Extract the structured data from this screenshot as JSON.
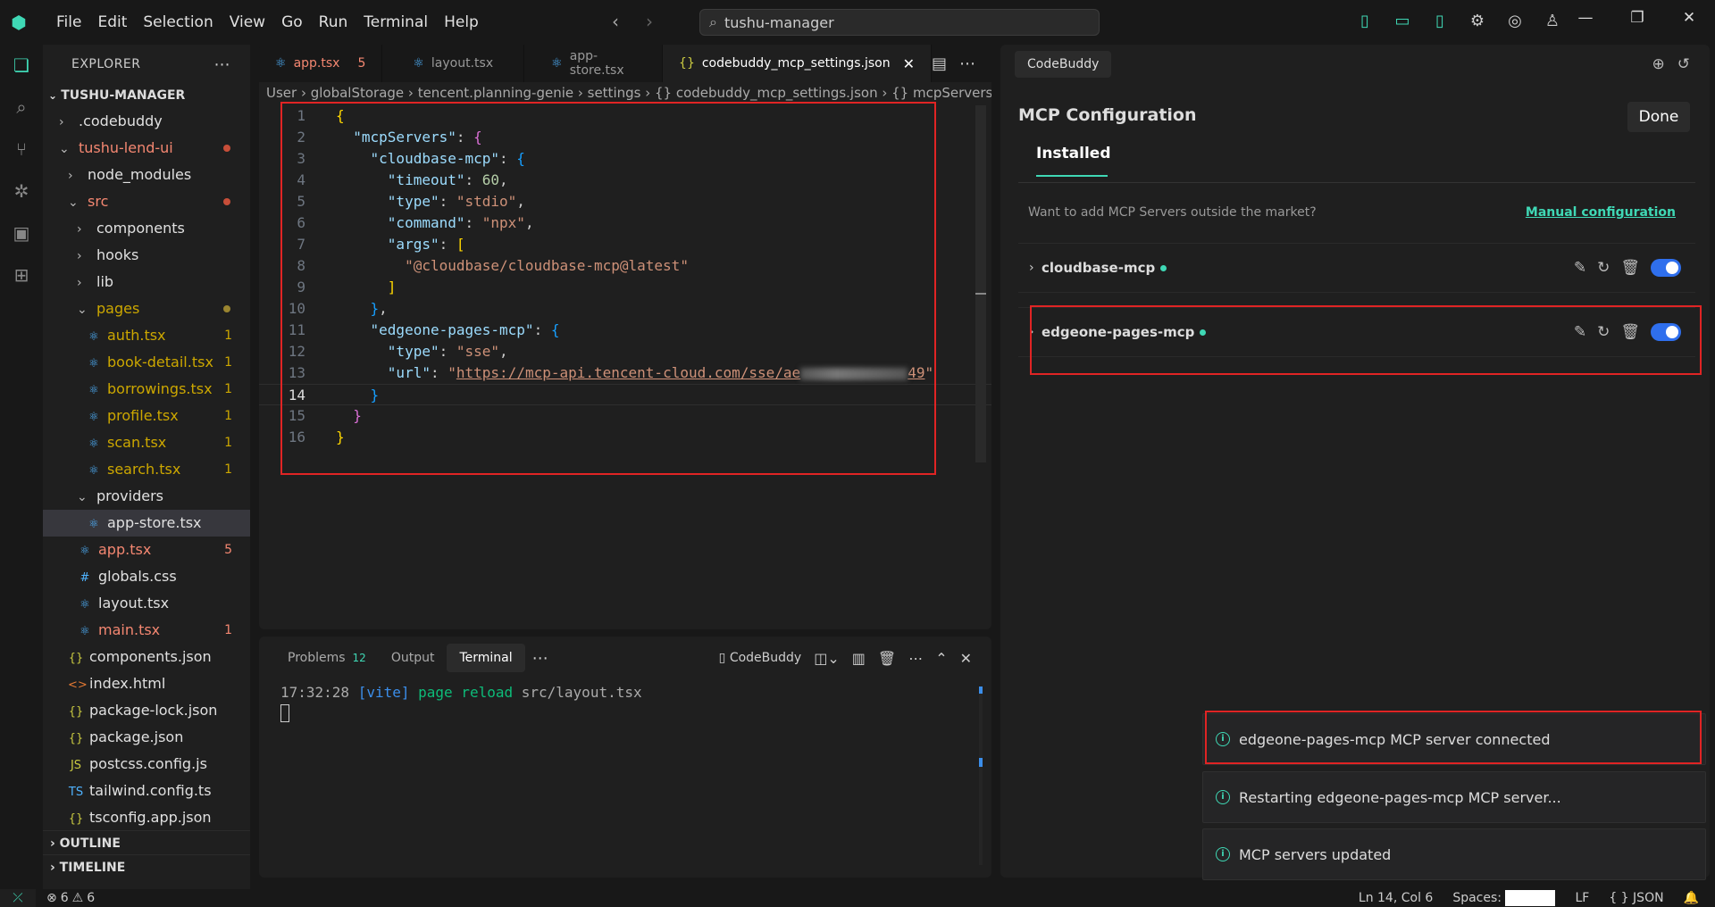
{
  "window": {
    "menu": [
      "File",
      "Edit",
      "Selection",
      "View",
      "Go",
      "Run",
      "Terminal",
      "Help"
    ],
    "search_text": "tushu-manager"
  },
  "explorer": {
    "header": "EXPLORER",
    "root": "TUSHU-MANAGER",
    "items": [
      {
        "label": ".codebuddy",
        "type": "folder",
        "open": false,
        "depth": 1
      },
      {
        "label": "tushu-lend-ui",
        "type": "folder",
        "open": true,
        "depth": 1,
        "status": "err-dot"
      },
      {
        "label": "node_modules",
        "type": "folder",
        "open": false,
        "depth": 2
      },
      {
        "label": "src",
        "type": "folder",
        "open": true,
        "depth": 2,
        "status": "err-dot"
      },
      {
        "label": "components",
        "type": "folder",
        "open": false,
        "depth": 3
      },
      {
        "label": "hooks",
        "type": "folder",
        "open": false,
        "depth": 3
      },
      {
        "label": "lib",
        "type": "folder",
        "open": false,
        "depth": 3
      },
      {
        "label": "pages",
        "type": "folder",
        "open": true,
        "depth": 3,
        "status": "warn-dot"
      },
      {
        "label": "auth.tsx",
        "type": "react",
        "depth": 4,
        "badge": "1",
        "color": "warn"
      },
      {
        "label": "book-detail.tsx",
        "type": "react",
        "depth": 4,
        "badge": "1",
        "color": "warn"
      },
      {
        "label": "borrowings.tsx",
        "type": "react",
        "depth": 4,
        "badge": "1",
        "color": "warn"
      },
      {
        "label": "profile.tsx",
        "type": "react",
        "depth": 4,
        "badge": "1",
        "color": "warn"
      },
      {
        "label": "scan.tsx",
        "type": "react",
        "depth": 4,
        "badge": "1",
        "color": "warn"
      },
      {
        "label": "search.tsx",
        "type": "react",
        "depth": 4,
        "badge": "1",
        "color": "warn"
      },
      {
        "label": "providers",
        "type": "folder",
        "open": true,
        "depth": 3
      },
      {
        "label": "app-store.tsx",
        "type": "react",
        "depth": 4,
        "selected": true
      },
      {
        "label": "app.tsx",
        "type": "react",
        "depth": 3,
        "badge": "5",
        "color": "err"
      },
      {
        "label": "globals.css",
        "type": "css",
        "depth": 3
      },
      {
        "label": "layout.tsx",
        "type": "react",
        "depth": 3
      },
      {
        "label": "main.tsx",
        "type": "react",
        "depth": 3,
        "badge": "1",
        "color": "err"
      },
      {
        "label": "components.json",
        "type": "json",
        "depth": 2
      },
      {
        "label": "index.html",
        "type": "html",
        "depth": 2
      },
      {
        "label": "package-lock.json",
        "type": "json",
        "depth": 2
      },
      {
        "label": "package.json",
        "type": "json",
        "depth": 2
      },
      {
        "label": "postcss.config.js",
        "type": "js",
        "depth": 2
      },
      {
        "label": "tailwind.config.ts",
        "type": "ts",
        "depth": 2
      },
      {
        "label": "tsconfig.app.json",
        "type": "json",
        "depth": 2
      }
    ],
    "outline": "OUTLINE",
    "timeline": "TIMELINE"
  },
  "editor": {
    "tabs": [
      {
        "label": "app.tsx",
        "badge": "5",
        "icon": "react-icon"
      },
      {
        "label": "layout.tsx",
        "icon": "react-icon"
      },
      {
        "label": "app-store.tsx",
        "icon": "react-icon"
      },
      {
        "label": "codebuddy_mcp_settings.json",
        "icon": "json-icon",
        "active": true
      }
    ],
    "breadcrumb": "User › globalStorage › tencent.planning-genie › settings › {} codebuddy_mcp_settings.json › {} mcpServers ›",
    "code": {
      "l1": "{",
      "k_mcpServers": "\"mcpServers\"",
      "k_cloudbase": "\"cloudbase-mcp\"",
      "k_timeout": "\"timeout\"",
      "v_timeout": "60",
      "k_type": "\"type\"",
      "v_stdio": "\"stdio\"",
      "k_command": "\"command\"",
      "v_npx": "\"npx\"",
      "k_args": "\"args\"",
      "v_arg": "\"@cloudbase/cloudbase-mcp@latest\"",
      "k_edgeone": "\"edgeone-pages-mcp\"",
      "v_sse": "\"sse\"",
      "k_url": "\"url\"",
      "v_url_start": "\"",
      "v_url_link": "https://mcp-api.tencent-cloud.com/sse/ae",
      "v_url_tail": "49",
      "v_url_end": "\""
    },
    "line_numbers": [
      "1",
      "2",
      "3",
      "4",
      "5",
      "6",
      "7",
      "8",
      "9",
      "10",
      "11",
      "12",
      "13",
      "14",
      "15",
      "16"
    ]
  },
  "panel": {
    "tabs": [
      "Problems",
      "Output",
      "Terminal"
    ],
    "problems_count": "12",
    "terminal_label": "CodeBuddy",
    "terminal_time": "17:32:28",
    "terminal_tag": "[vite]",
    "terminal_msg": "page reload",
    "terminal_path": "src/layout.tsx"
  },
  "codebuddy": {
    "tab": "CodeBuddy",
    "title": "MCP Configuration",
    "done": "Done",
    "installed": "Installed",
    "hint": "Want to add MCP Servers outside the market?",
    "manual": "Manual configuration",
    "servers": [
      {
        "name": "cloudbase-mcp",
        "enabled": true
      },
      {
        "name": "edgeone-pages-mcp",
        "enabled": true
      }
    ]
  },
  "toasts": [
    "edgeone-pages-mcp MCP server connected",
    "Restarting edgeone-pages-mcp MCP server...",
    "MCP servers updated"
  ],
  "status": {
    "errors": "6",
    "warnings": "6",
    "position": "Ln 14, Col 6",
    "spaces": "Spaces:",
    "eol": "LF",
    "lang": "JSON"
  },
  "colors": {
    "accent": "#3fd8b5",
    "error": "#f48771",
    "warning": "#cca700",
    "highlight": "#e02424"
  }
}
